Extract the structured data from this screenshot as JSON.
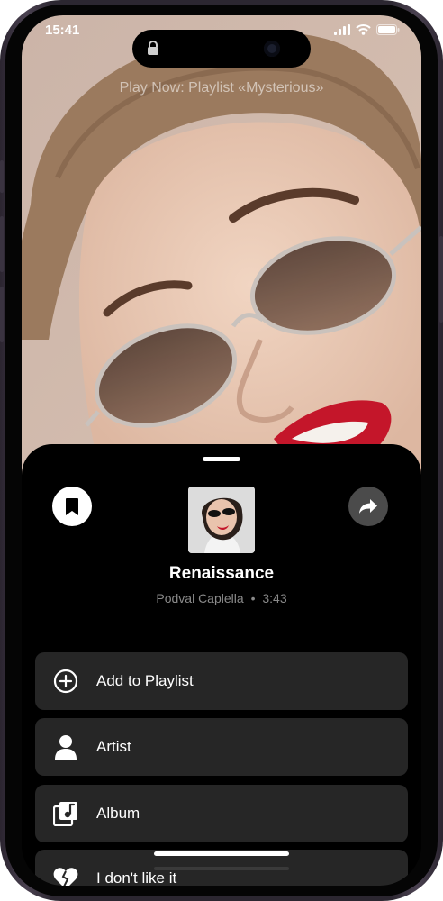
{
  "status_bar": {
    "time": "15:41"
  },
  "now_playing_text": "Play Now: Playlist «Mysterious»",
  "track": {
    "title": "Renaissance",
    "artist": "Podval Caplella",
    "separator": "•",
    "duration": "3:43"
  },
  "actions": {
    "bookmark_icon": "bookmark-icon",
    "share_icon": "share-icon"
  },
  "menu": [
    {
      "label": "Add to Playlist",
      "icon": "add-circle-icon"
    },
    {
      "label": "Artist",
      "icon": "person-icon"
    },
    {
      "label": "Album",
      "icon": "album-icon"
    },
    {
      "label": "I don't like it",
      "icon": "broken-heart-icon"
    }
  ],
  "colors": {
    "sheet_bg": "#000000",
    "menu_item_bg": "#262626",
    "accent_red": "#c4162a"
  }
}
